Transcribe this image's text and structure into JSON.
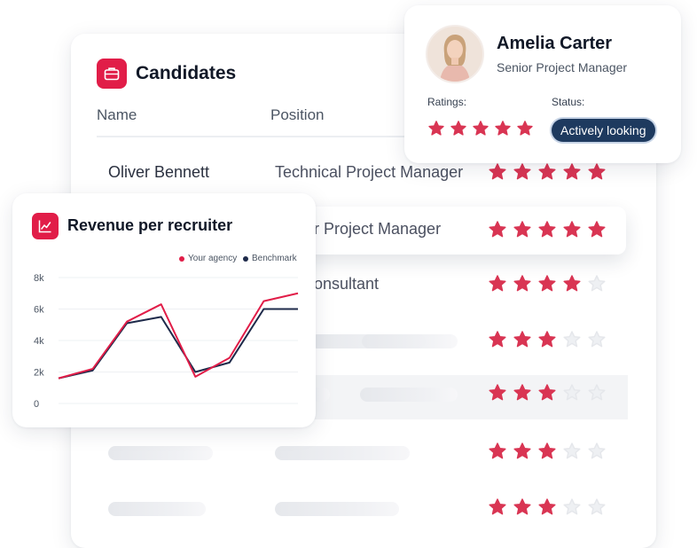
{
  "colors": {
    "accent": "#e11d48",
    "star_filled": "#d93553",
    "star_empty": "#eef0f3",
    "benchmark": "#1e2a4a",
    "status_bg": "#1e3a5f"
  },
  "candidates": {
    "title": "Candidates",
    "icon": "briefcase-icon",
    "columns": {
      "name": "Name",
      "position": "Position"
    },
    "rows": [
      {
        "name": "Oliver Bennett",
        "position": "Technical Project Manager",
        "rating": 5
      },
      {
        "name": "",
        "position": "r Project Manager",
        "rating": 5
      },
      {
        "name": "",
        "position": "r Consultant",
        "rating": 4
      },
      {
        "name": "",
        "position": "",
        "rating": 3
      },
      {
        "name": "",
        "position": "",
        "rating": 3
      },
      {
        "name": "",
        "position": "",
        "rating": 3
      },
      {
        "name": "",
        "position": "",
        "rating": 3
      }
    ]
  },
  "profile": {
    "name": "Amelia Carter",
    "role": "Senior Project Manager",
    "ratings_label": "Ratings:",
    "status_label": "Status:",
    "rating": 5,
    "status": "Actively looking"
  },
  "revenue": {
    "title": "Revenue per recruiter",
    "icon": "line-chart-icon"
  },
  "chart_data": {
    "type": "line",
    "title": "Revenue per recruiter",
    "x": [
      0,
      1,
      2,
      3,
      4,
      5,
      6,
      7
    ],
    "series": [
      {
        "name": "Your agency",
        "color": "#e11d48",
        "values": [
          1600,
          2200,
          5200,
          6300,
          1700,
          2900,
          6500,
          7000
        ]
      },
      {
        "name": "Benchmark",
        "color": "#1e2a4a",
        "values": [
          1600,
          2100,
          5100,
          5500,
          2000,
          2600,
          6000,
          6000
        ]
      }
    ],
    "yticks": [
      "8k",
      "6k",
      "4k",
      "2k",
      "0"
    ],
    "ytick_values": [
      8000,
      6000,
      4000,
      2000,
      0
    ],
    "ylim": [
      0,
      8000
    ],
    "legend_position": "top-right",
    "grid": true
  }
}
